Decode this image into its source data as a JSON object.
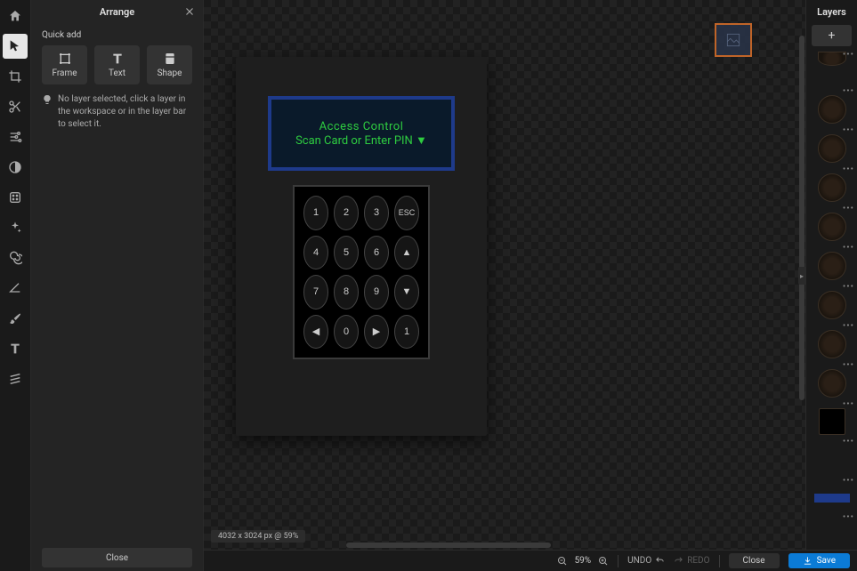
{
  "left_tools": [
    "home",
    "pointer",
    "crop",
    "cut",
    "sliders",
    "contrast",
    "pattern",
    "sparkle",
    "spiral",
    "angle",
    "brush",
    "text",
    "hatch"
  ],
  "arrange": {
    "title": "Arrange",
    "quickadd_label": "Quick add",
    "frame": "Frame",
    "text": "Text",
    "shape": "Shape",
    "hint": "No layer selected, click a layer in the workspace or in the layer bar to select it.",
    "close": "Close"
  },
  "canvas": {
    "dimensions": "4032 x 3024 px @ 59%",
    "lcd_line1": "Access Control",
    "lcd_line2": "Scan Card or Enter PIN ▼",
    "keys": [
      "1",
      "2",
      "3",
      "ESC",
      "4",
      "5",
      "6",
      "▲",
      "7",
      "8",
      "9",
      "▼",
      "◀",
      "0",
      "▶",
      "1"
    ]
  },
  "layers": {
    "title": "Layers"
  },
  "bottom": {
    "zoom": "59%",
    "undo": "UNDO",
    "redo": "REDO",
    "close": "Close",
    "save": "Save"
  }
}
